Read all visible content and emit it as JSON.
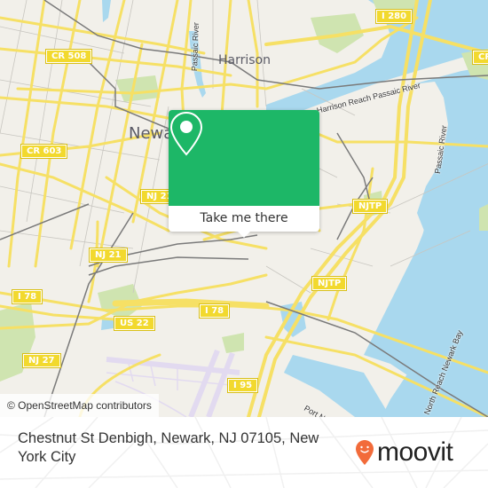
{
  "map": {
    "attribution": "© OpenStreetMap contributors",
    "colors": {
      "land": "#f2f0ea",
      "water": "#a9d8ee",
      "park": "#cfe4b0",
      "road_major": "#f6e065",
      "road_minor": "#ffffff",
      "rail": "#7a7a7a",
      "airport": "#e2daf0",
      "shield_bg": "#f2d92e"
    },
    "place_labels": {
      "newark": "Newark",
      "harrison": "Harrison"
    },
    "road_shields": {
      "cr508": "CR 508",
      "cr603": "CR 603",
      "i280": "I 280",
      "cr_partial": "CR",
      "nj21_top": "NJ 21",
      "nj21": "NJ 21",
      "i78_left": "I 78",
      "i78_mid": "I 78",
      "us22": "US 22",
      "nj27": "NJ 27",
      "i95": "I 95",
      "njtp_top": "NJTP",
      "njtp_bottom": "NJTP"
    },
    "water_labels": {
      "passaic_north": "Passaic River",
      "harrison_reach": "Harrison Reach Passaic River",
      "passaic_east": "Passaic River",
      "port_newark": "Port Newark Channel",
      "newark_bay": "North Reach Newark Bay"
    }
  },
  "popup": {
    "icon": "location-pin-icon",
    "button_label": "Take me there",
    "color": "#1db767"
  },
  "footer": {
    "address": "Chestnut St Denbigh, Newark, NJ 07105, New York City",
    "brand": "moovit",
    "brand_color": "#f26b3a"
  }
}
